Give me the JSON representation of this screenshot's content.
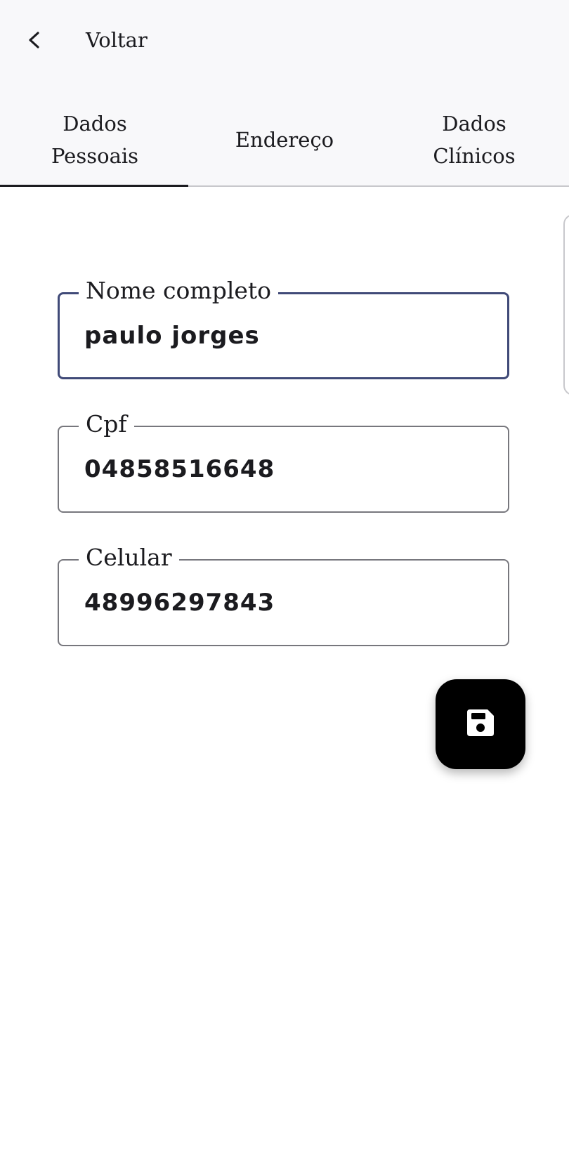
{
  "header": {
    "back_label": "Voltar",
    "back_icon": "chevron-left-icon"
  },
  "tabs": [
    {
      "line1": "Dados",
      "line2": "Pessoais",
      "selected": true
    },
    {
      "label": "Endereço",
      "selected": false
    },
    {
      "line1": "Dados",
      "line2": "Clínicos",
      "selected": false
    }
  ],
  "form": {
    "full_name": {
      "label": "Nome completo",
      "value": "paulo jorges",
      "focused": true
    },
    "cpf": {
      "label": "Cpf",
      "value": "04858516648"
    },
    "phone": {
      "label": "Celular",
      "value": "48996297843"
    }
  },
  "fab": {
    "icon": "save-icon"
  },
  "colors": {
    "focus_border": "#404a78",
    "field_border": "#77777d",
    "header_background": "#f8f8fa",
    "fab_background": "#000000"
  }
}
